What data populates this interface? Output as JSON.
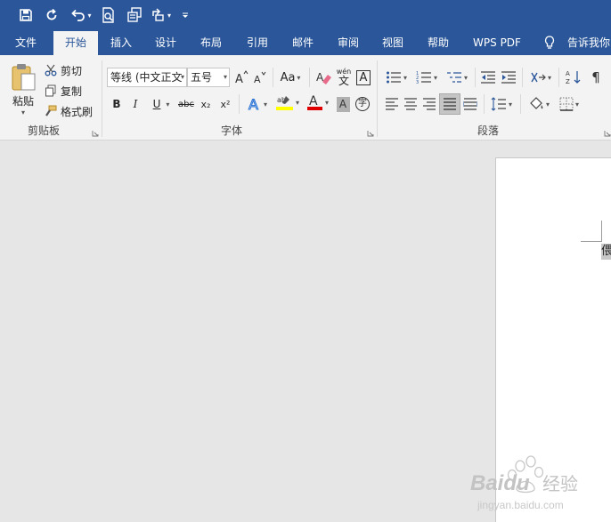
{
  "quick_access": {
    "icons": [
      "save-icon",
      "autosave-icon",
      "undo-icon",
      "print-preview-icon",
      "copy-format-icon",
      "share-icon",
      "customize-icon"
    ]
  },
  "tabs": [
    {
      "label": "文件",
      "active": false
    },
    {
      "label": "开始",
      "active": true
    },
    {
      "label": "插入",
      "active": false
    },
    {
      "label": "设计",
      "active": false
    },
    {
      "label": "布局",
      "active": false
    },
    {
      "label": "引用",
      "active": false
    },
    {
      "label": "邮件",
      "active": false
    },
    {
      "label": "审阅",
      "active": false
    },
    {
      "label": "视图",
      "active": false
    },
    {
      "label": "帮助",
      "active": false
    },
    {
      "label": "WPS PDF",
      "active": false
    },
    {
      "label": "告诉我你",
      "active": false
    }
  ],
  "clipboard": {
    "paste": "粘贴",
    "cut": "剪切",
    "copy": "复制",
    "format_painter": "格式刷",
    "group_label": "剪贴板"
  },
  "font": {
    "font_name": "等线 (中文正文",
    "font_size": "五号",
    "case_label": "Aa",
    "bold": "B",
    "italic": "I",
    "underline": "U",
    "strike": "abc",
    "subscript": "x₂",
    "superscript": "x²",
    "phonetic": "wén",
    "phonetic_char": "文",
    "char_border": "A",
    "font_color_letter": "A",
    "shading_letter": "A",
    "enclose_char": "字",
    "group_label": "字体"
  },
  "paragraph": {
    "group_label": "段落"
  },
  "document": {
    "selected_char": "偎"
  },
  "watermark": {
    "brand": "Baidu",
    "cn": "经验",
    "url": "jingyan.baidu.com"
  },
  "colors": {
    "accent": "#2b579a",
    "ribbon_bg": "#f3f3f3",
    "highlight": "#ffff00",
    "font_red": "#e00000"
  }
}
